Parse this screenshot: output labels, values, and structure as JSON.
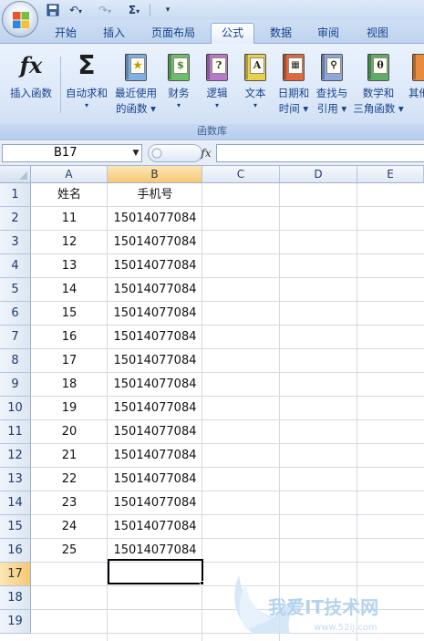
{
  "quick_access": {
    "sigma_label": "Σ"
  },
  "tabs": [
    {
      "label": "开始",
      "active": false
    },
    {
      "label": "插入",
      "active": false
    },
    {
      "label": "页面布局",
      "active": false
    },
    {
      "label": "公式",
      "active": true
    },
    {
      "label": "数据",
      "active": false
    },
    {
      "label": "审阅",
      "active": false
    },
    {
      "label": "视图",
      "active": false
    }
  ],
  "ribbon": {
    "buttons": [
      {
        "id": "insert-function",
        "line1": "插入函数",
        "line2": "",
        "icon": "fx-icon"
      },
      {
        "id": "autosum",
        "line1": "自动求和",
        "line2": "▾",
        "icon": "sigma-icon"
      },
      {
        "id": "recent",
        "line1": "最近使用",
        "line2": "的函数 ▾",
        "icon": "star-book-icon",
        "color": "#7fb0e0",
        "glyph": "★"
      },
      {
        "id": "financial",
        "line1": "财务",
        "line2": "▾",
        "icon": "money-book-icon",
        "color": "#6fbf6a",
        "glyph": "$"
      },
      {
        "id": "logical",
        "line1": "逻辑",
        "line2": "▾",
        "icon": "question-book-icon",
        "color": "#b77ac9",
        "glyph": "?"
      },
      {
        "id": "text",
        "line1": "文本",
        "line2": "▾",
        "icon": "text-book-icon",
        "color": "#e9d24a",
        "glyph": "A"
      },
      {
        "id": "datetime",
        "line1": "日期和",
        "line2": "时间 ▾",
        "icon": "calendar-book-icon",
        "color": "#e0683f",
        "glyph": "▦"
      },
      {
        "id": "lookup",
        "line1": "查找与",
        "line2": "引用 ▾",
        "icon": "magnifier-book-icon",
        "color": "#8fa6d8",
        "glyph": "⚲"
      },
      {
        "id": "math",
        "line1": "数学和",
        "line2": "三角函数 ▾",
        "icon": "theta-book-icon",
        "color": "#5fae64",
        "glyph": "θ"
      },
      {
        "id": "more",
        "line1": "其他",
        "line2": "",
        "icon": "more-book-icon",
        "color": "#e98a3d",
        "glyph": ""
      }
    ],
    "group_label": "函数库"
  },
  "formula_bar": {
    "name_box": "B17",
    "fx_label": "fx",
    "value": ""
  },
  "grid": {
    "columns": [
      "A",
      "B",
      "C",
      "D",
      "E"
    ],
    "selected_column": "B",
    "rows": [
      "1",
      "2",
      "3",
      "4",
      "5",
      "6",
      "7",
      "8",
      "9",
      "10",
      "11",
      "12",
      "13",
      "14",
      "15",
      "16",
      "17",
      "18",
      "19"
    ],
    "selected_row": "17",
    "headers": {
      "A": "姓名",
      "B": "手机号"
    },
    "data": [
      {
        "a": "11",
        "b": "15014077084"
      },
      {
        "a": "12",
        "b": "15014077084"
      },
      {
        "a": "13",
        "b": "15014077084"
      },
      {
        "a": "14",
        "b": "15014077084"
      },
      {
        "a": "15",
        "b": "15014077084"
      },
      {
        "a": "16",
        "b": "15014077084"
      },
      {
        "a": "17",
        "b": "15014077084"
      },
      {
        "a": "18",
        "b": "15014077084"
      },
      {
        "a": "19",
        "b": "15014077084"
      },
      {
        "a": "20",
        "b": "15014077084"
      },
      {
        "a": "21",
        "b": "15014077084"
      },
      {
        "a": "22",
        "b": "15014077084"
      },
      {
        "a": "23",
        "b": "15014077084"
      },
      {
        "a": "24",
        "b": "15014077084"
      },
      {
        "a": "25",
        "b": "15014077084"
      }
    ]
  },
  "watermark": {
    "title": "我爱IT技术网",
    "url": "www.52ij.com"
  }
}
